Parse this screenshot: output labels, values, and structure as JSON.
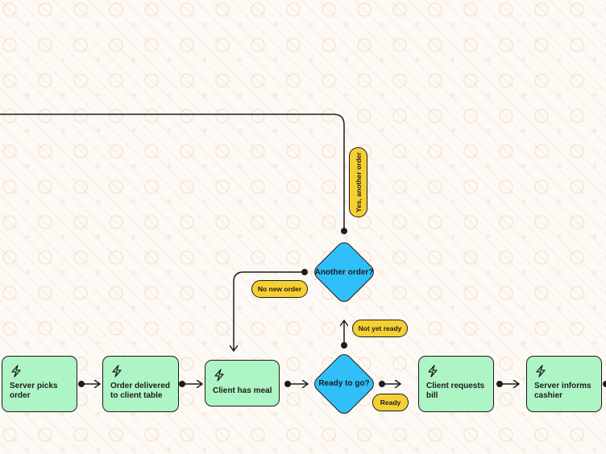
{
  "nodes": {
    "server_picks_order": "Server picks order",
    "order_delivered": "Order delivered to client table",
    "client_has_meal": "Client has meal",
    "client_requests_bill": "Client requests bill",
    "server_informs_cashier": "Server informs cashier"
  },
  "decisions": {
    "ready_to_go": "Ready to go?",
    "another_order": "Another order?"
  },
  "edge_labels": {
    "ready": "Ready",
    "not_yet_ready": "Not yet ready",
    "no_new_order": "No new order",
    "yes_another_order": "Yes, another order"
  },
  "colors": {
    "task": "#adf5c4",
    "decision": "#30bff8",
    "label": "#f5d033",
    "background": "#fdf9f5"
  },
  "icons": {
    "task": "lightning-bolt-icon"
  }
}
